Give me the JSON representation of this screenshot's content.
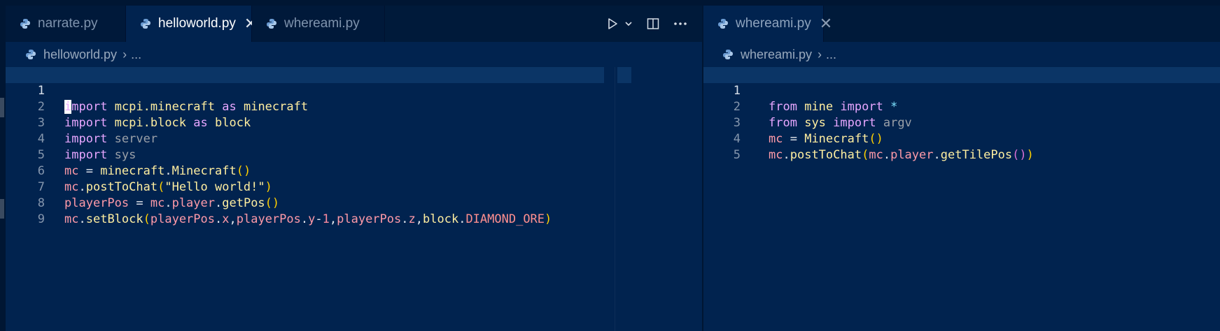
{
  "left_group": {
    "tabs": [
      {
        "label": "narrate.py",
        "active": false
      },
      {
        "label": "helloworld.py",
        "active": true,
        "close": "✕"
      },
      {
        "label": "whereami.py",
        "active": false
      }
    ],
    "breadcrumb": {
      "file": "helloworld.py",
      "separator": "›",
      "rest": "..."
    },
    "lines": [
      {
        "n": "1"
      },
      {
        "n": "2"
      },
      {
        "n": "3"
      },
      {
        "n": "4"
      },
      {
        "n": "5"
      },
      {
        "n": "6"
      },
      {
        "n": "7"
      },
      {
        "n": "8"
      },
      {
        "n": "9"
      }
    ]
  },
  "right_group": {
    "tabs": [
      {
        "label": "whereami.py",
        "active": true,
        "close": "✕"
      }
    ],
    "breadcrumb": {
      "file": "whereami.py",
      "separator": "›",
      "rest": "..."
    },
    "lines": [
      {
        "n": "1"
      },
      {
        "n": "2"
      },
      {
        "n": "3"
      },
      {
        "n": "4"
      },
      {
        "n": "5"
      }
    ]
  },
  "code": {
    "left": {
      "l1": [
        "i",
        "mport",
        " ",
        "mcpi.minecraft",
        " ",
        "as",
        " ",
        "minecraft"
      ],
      "l2": [
        "import",
        " ",
        "mcpi.block",
        " ",
        "as",
        " ",
        "block"
      ],
      "l3": [
        "import",
        " ",
        "server"
      ],
      "l4": [
        "import",
        " ",
        "sys"
      ],
      "l5": [
        "mc",
        " = ",
        "minecraft",
        ".",
        "Minecraft",
        "()"
      ],
      "l6": [
        "mc",
        ".",
        "postToChat",
        "(",
        "\"Hello world!\"",
        ")"
      ],
      "l7": [
        "playerPos",
        " = ",
        "mc",
        ".",
        "player",
        ".",
        "getPos",
        "()"
      ],
      "l8": [
        "mc",
        ".",
        "setBlock",
        "(",
        "playerPos",
        ".",
        "x",
        ",",
        "playerPos",
        ".",
        "y",
        "-",
        "1",
        ",",
        "playerPos",
        ".",
        "z",
        ",",
        "block",
        ".",
        "DIAMOND_ORE",
        ")"
      ]
    },
    "right": {
      "l1": [
        "from",
        " ",
        "mine",
        " ",
        "import",
        " ",
        "*"
      ],
      "l2": [
        "from",
        " ",
        "sys",
        " ",
        "import",
        " ",
        "argv"
      ],
      "l3": [
        "mc",
        " = ",
        "Minecraft",
        "()"
      ],
      "l4": [
        "mc",
        ".",
        "postToChat",
        "(",
        "mc",
        ".",
        "player",
        ".",
        "getTilePos",
        "()",
        ")"
      ]
    }
  },
  "icons": {
    "file": "python-icon",
    "run": "play-icon",
    "run_menu": "chevron-down-icon",
    "split": "split-editor-icon",
    "more": "ellipsis-icon"
  },
  "colors": {
    "background": "#01234f",
    "tab_inactive": "#00193a",
    "current_line": "#0b3566",
    "keyword": "#e7a6ff",
    "identifier": "#ff9aa8",
    "function": "#ffeea0",
    "bracket": "#ffd000"
  }
}
